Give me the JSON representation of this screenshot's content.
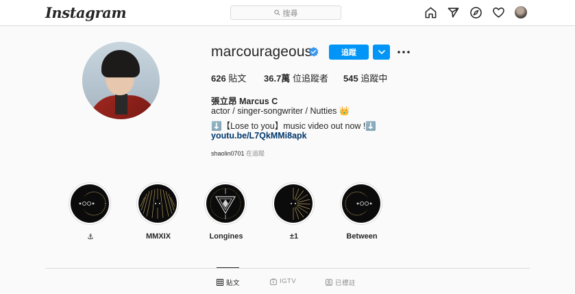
{
  "nav": {
    "logo": "Instagram",
    "search_placeholder": "搜尋",
    "icons": [
      "home-icon",
      "send-icon",
      "explore-icon",
      "heart-icon"
    ]
  },
  "profile": {
    "username": "marcourageous",
    "verified": true,
    "follow_label": "追蹤",
    "stats": {
      "posts_count": "626",
      "posts_label": "貼文",
      "followers_count": "36.7萬",
      "followers_label": "位追蹤者",
      "following_count": "545",
      "following_label": "追蹤中"
    },
    "full_name": "張立昂 Marcus C",
    "bio": {
      "line1": "actor / singer-songwriter / Nutties 👑",
      "line2": "⬇️【Lose to you】music video out now !⬇️",
      "link": "youtu.be/L7QkMMi8apk"
    },
    "followed_by_user": "shaolin0701",
    "followed_by_suffix": " 在追蹤"
  },
  "highlights": [
    {
      "label": "⚓"
    },
    {
      "label": "MMXIX"
    },
    {
      "label": "Longines"
    },
    {
      "label": "±1"
    },
    {
      "label": "Between"
    }
  ],
  "tabs": [
    {
      "label": "貼文",
      "active": true
    },
    {
      "label": "IGTV",
      "active": false
    },
    {
      "label": "已標註",
      "active": false
    }
  ],
  "colors": {
    "accent": "#0095f6",
    "link": "#00376b",
    "border": "#dbdbdb",
    "background": "#fafafa"
  }
}
